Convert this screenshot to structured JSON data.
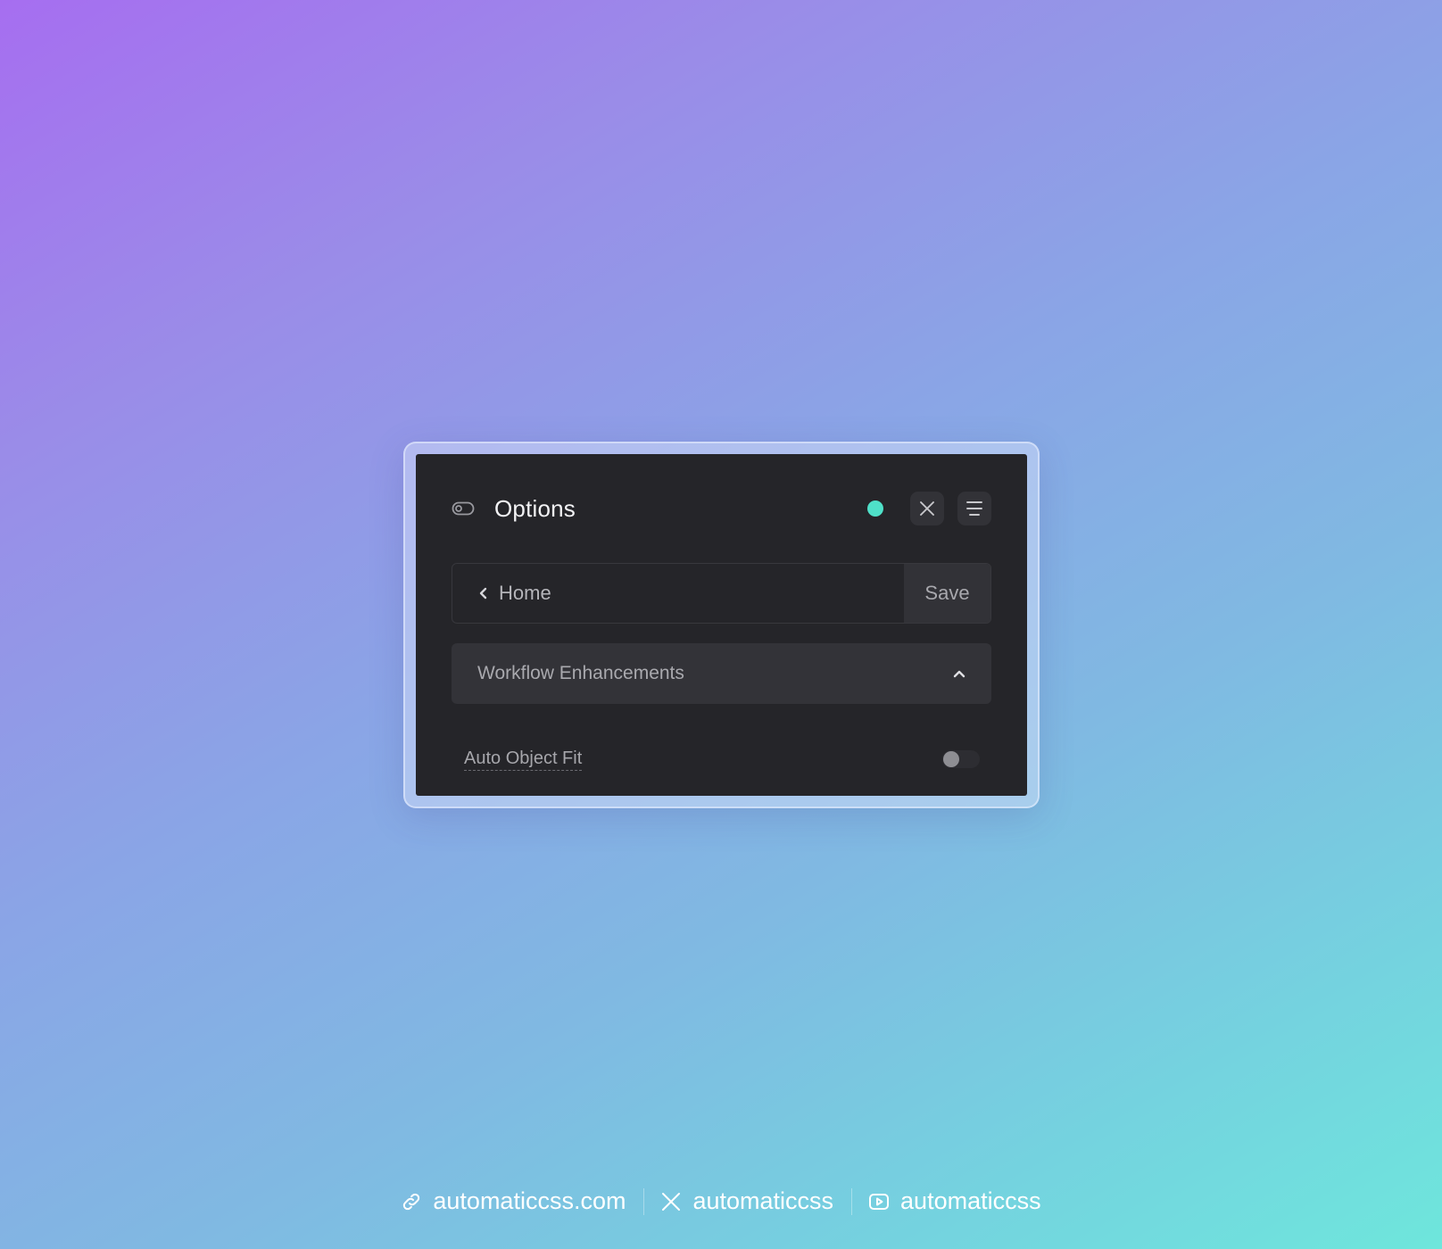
{
  "colors": {
    "status_dot": "#4fe0c8",
    "panel_bg": "#252529",
    "accent_text": "#ffffff"
  },
  "panel": {
    "icon": "toggle-icon",
    "title": "Options",
    "status_icon": "status-dot",
    "close_icon": "close-icon",
    "menu_icon": "menu-icon"
  },
  "nav": {
    "back_icon": "chevron-left-icon",
    "home_label": "Home",
    "save_label": "Save"
  },
  "section": {
    "title": "Workflow Enhancements",
    "expanded": true,
    "chevron_icon": "chevron-up-icon"
  },
  "options": [
    {
      "label": "Auto Object Fit",
      "enabled": false
    }
  ],
  "footer": {
    "links": [
      {
        "icon": "link-icon",
        "label": "automaticcss.com"
      },
      {
        "icon": "x-icon",
        "label": "automaticcss"
      },
      {
        "icon": "youtube-icon",
        "label": "automaticcss"
      }
    ]
  }
}
